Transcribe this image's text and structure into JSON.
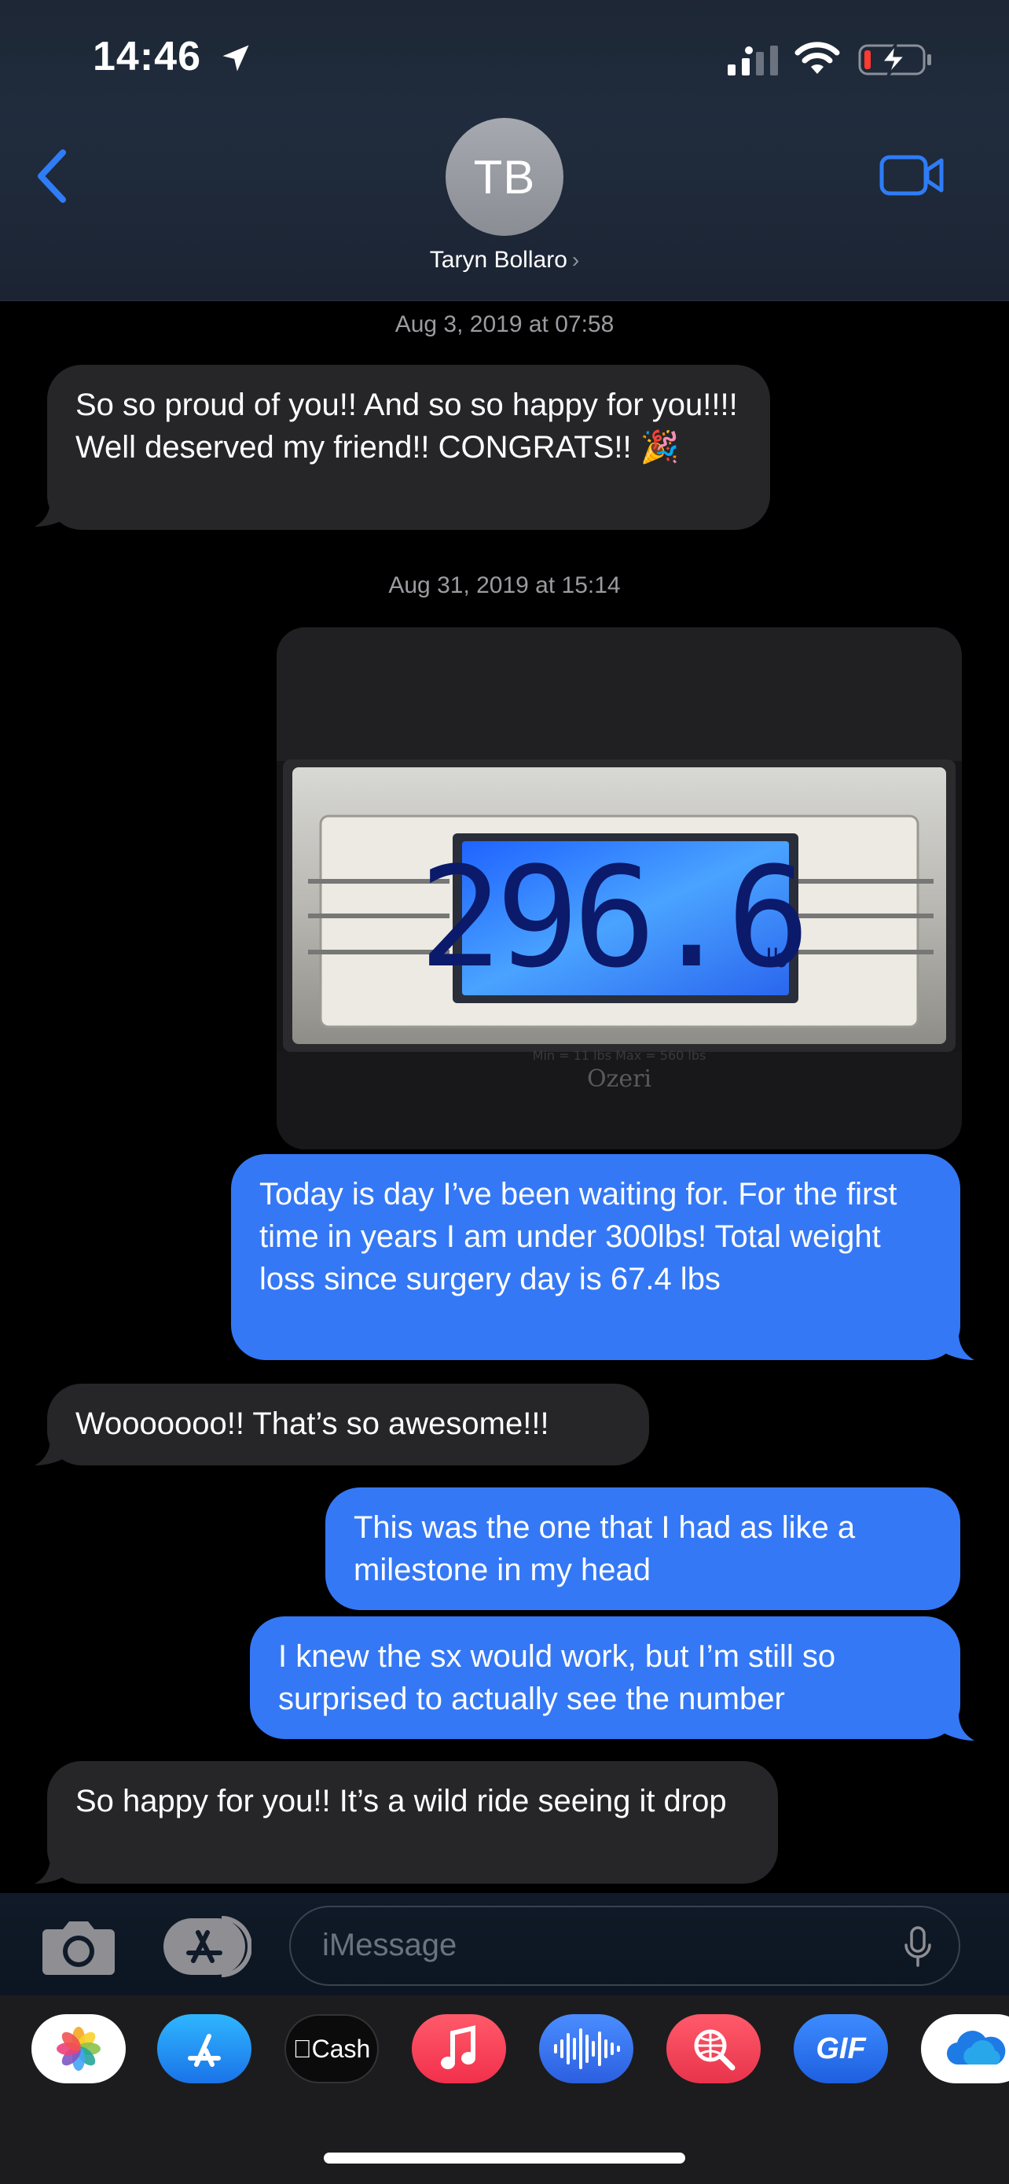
{
  "status_bar": {
    "time": "14:46"
  },
  "header": {
    "avatar_initials": "TB",
    "contact_name": "Taryn Bollaro",
    "name_chevron": "›"
  },
  "messages": {
    "stamp1": "Aug 3, 2019 at 07:58",
    "m1": "So so proud of you!! And so so happy for you!!!! Well deserved my friend!! CONGRATS!! 🎉",
    "stamp2": "Aug 31, 2019 at 15:14",
    "photo": {
      "reading": "296.6",
      "unit": "lb",
      "range": "Min = 11 lbs  Max = 560 lbs",
      "brand": "Ozeri"
    },
    "m2": "Today is day I’ve been waiting for. For the first time in years I am under 300lbs! Total weight loss since surgery day is 67.4 lbs",
    "m3": "Wooooooo!! That’s so awesome!!!",
    "m4": "This was the one that I had as like a milestone in my head",
    "m5": "I knew the sx would work, but I’m still so surprised to actually see the number",
    "m6": "So happy for you!! It’s a wild ride seeing it drop"
  },
  "compose": {
    "placeholder": "iMessage"
  },
  "apps": {
    "cash_label": "Cash",
    "gif_label": "GIF"
  },
  "colors": {
    "outgoing": "#3478f6",
    "incoming": "#262629",
    "accent": "#2f7cf6"
  },
  "icons": [
    "location-arrow-icon",
    "signal-icon",
    "wifi-icon",
    "battery-charging-icon",
    "back-chevron-icon",
    "video-camera-icon",
    "camera-icon",
    "app-store-icon",
    "microphone-icon",
    "photos-icon",
    "music-icon",
    "audio-wave-icon",
    "web-search-icon",
    "cloud-icon"
  ]
}
